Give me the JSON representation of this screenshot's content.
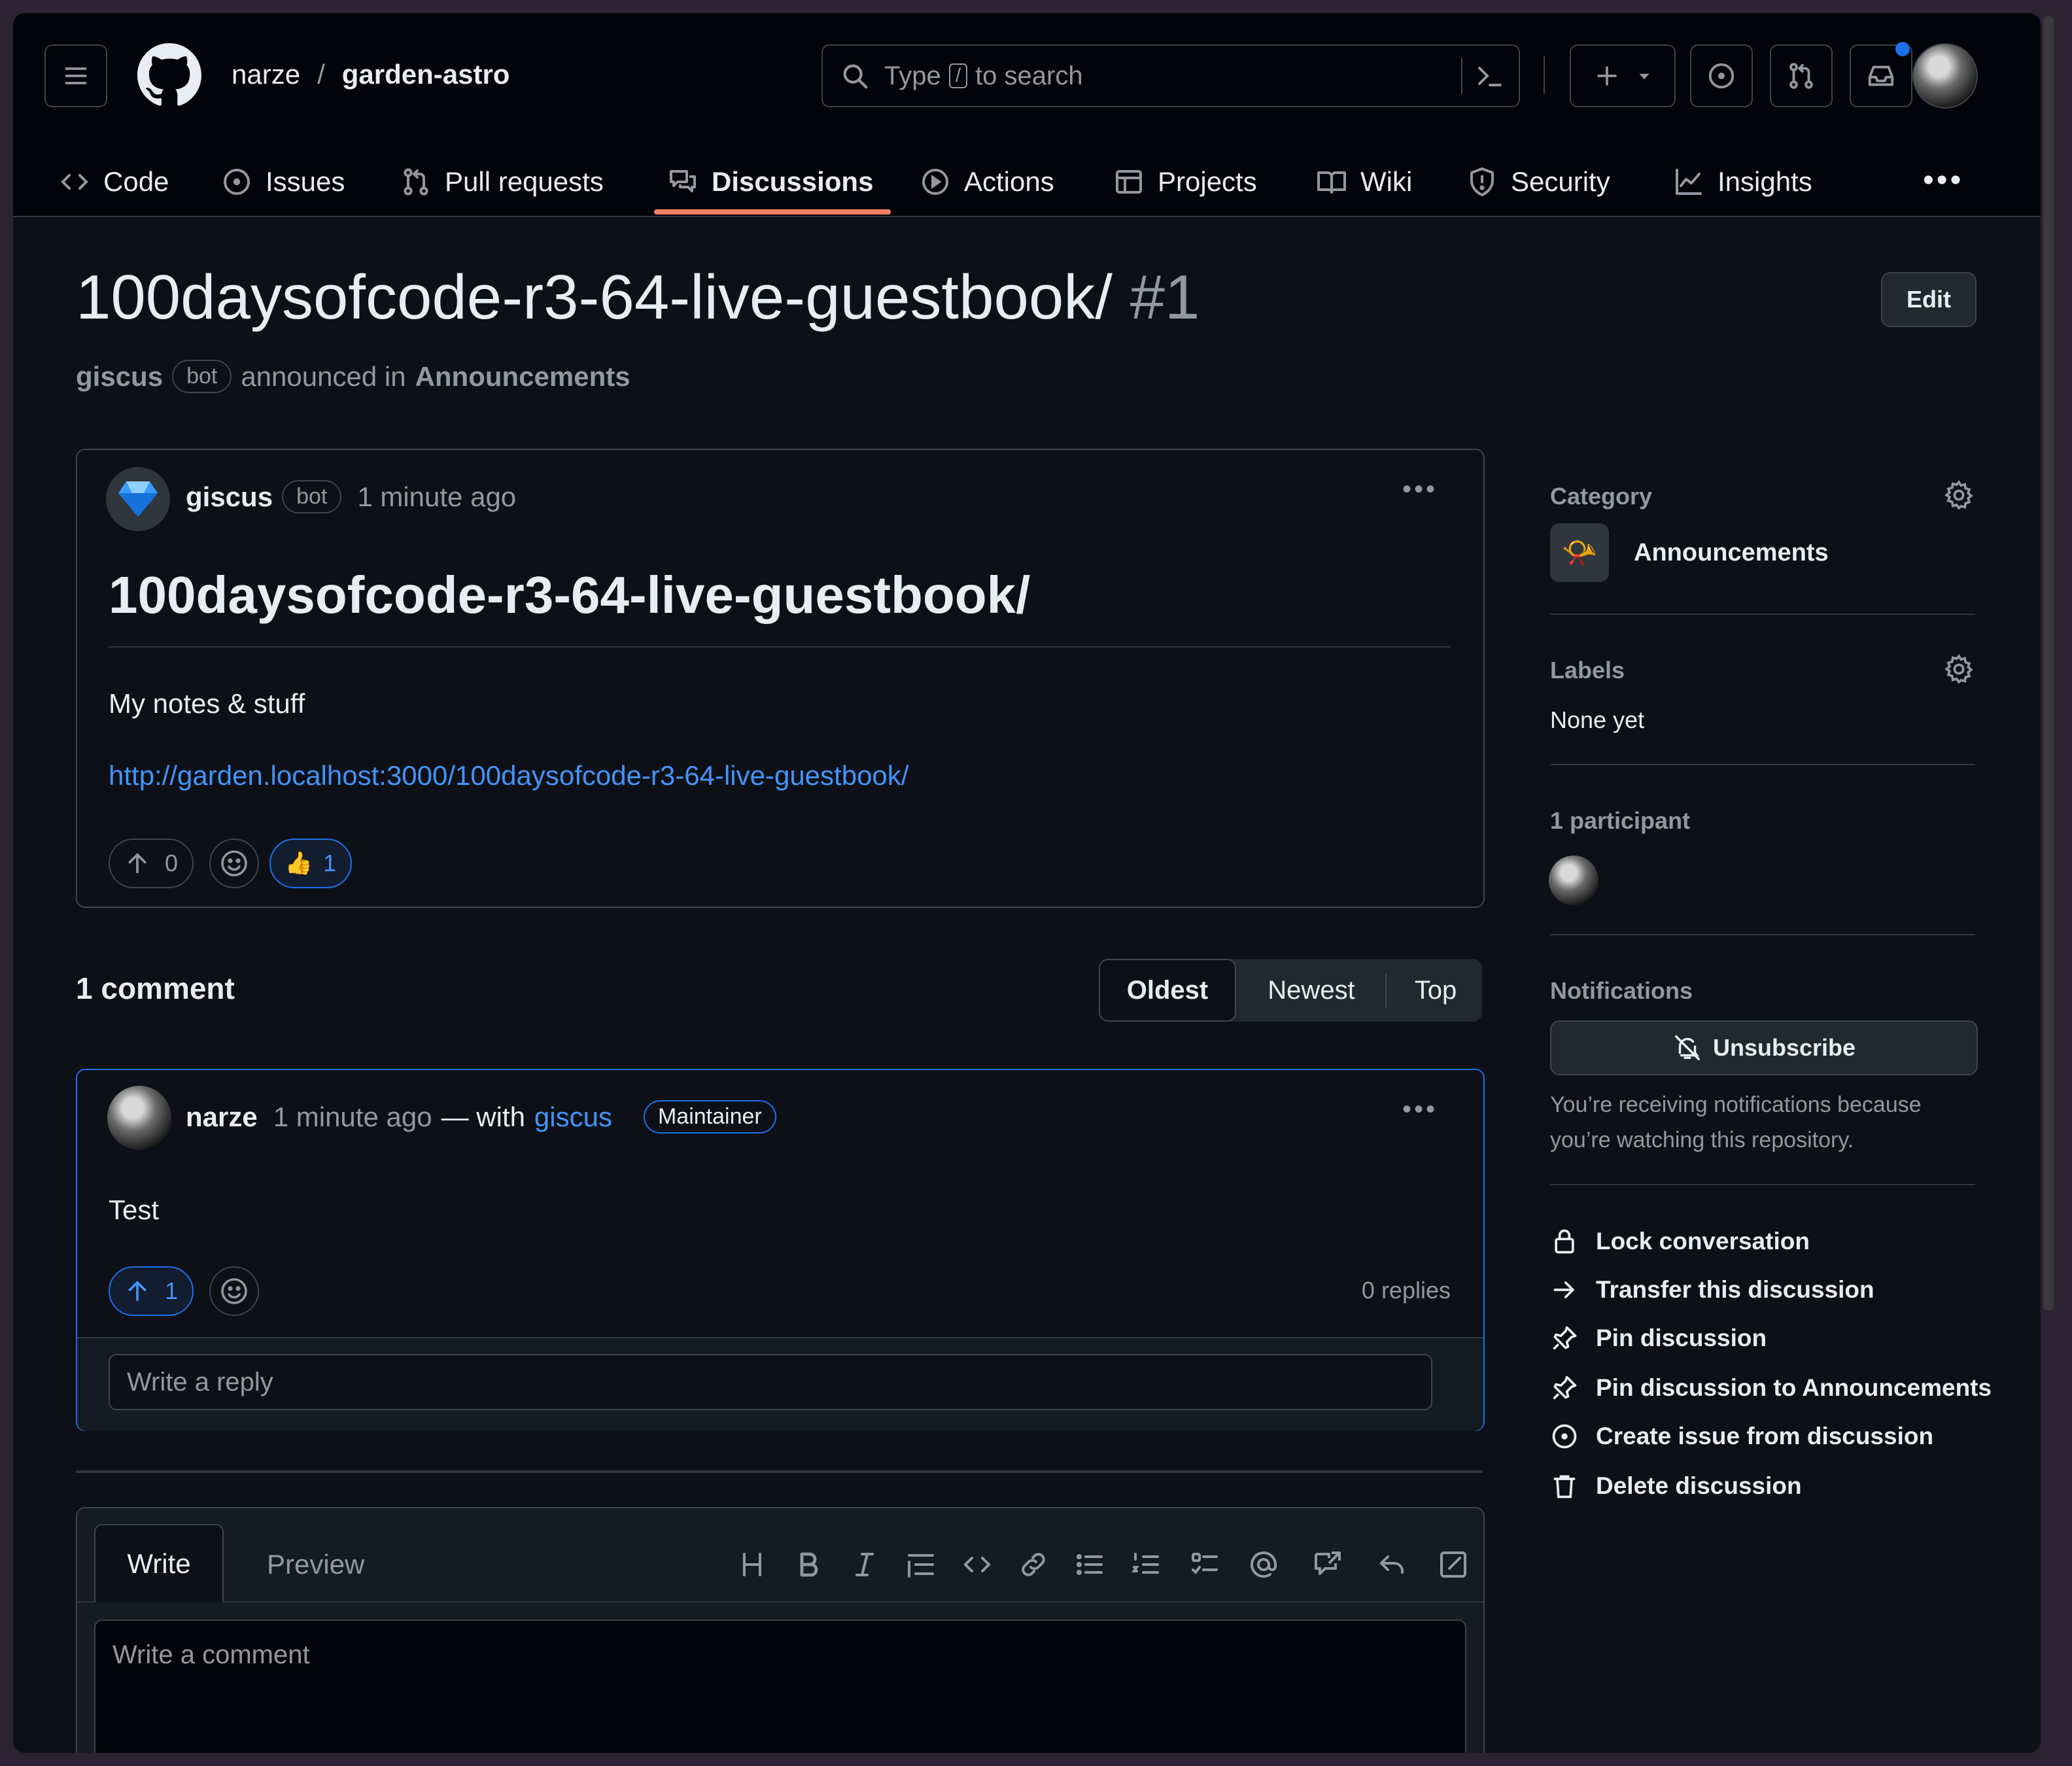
{
  "header": {
    "owner": "narze",
    "separator": "/",
    "repo": "garden-astro",
    "search": {
      "prefix": "Type",
      "key": "/",
      "suffix": "to search"
    }
  },
  "nav": [
    {
      "label": "Code",
      "icon": "code-icon"
    },
    {
      "label": "Issues",
      "icon": "issue-icon"
    },
    {
      "label": "Pull requests",
      "icon": "pull-request-icon"
    },
    {
      "label": "Discussions",
      "icon": "discussion-icon",
      "selected": true
    },
    {
      "label": "Actions",
      "icon": "play-icon"
    },
    {
      "label": "Projects",
      "icon": "table-icon"
    },
    {
      "label": "Wiki",
      "icon": "book-icon"
    },
    {
      "label": "Security",
      "icon": "shield-icon"
    },
    {
      "label": "Insights",
      "icon": "graph-icon"
    }
  ],
  "discussion": {
    "title": "100daysofcode-r3-64-live-guestbook/",
    "number": "#1",
    "edit_label": "Edit",
    "author": "giscus",
    "bot_label": "bot",
    "announced_in": "announced in",
    "category": "Announcements"
  },
  "post": {
    "author": "giscus",
    "bot_label": "bot",
    "time": "1 minute ago",
    "heading": "100daysofcode-r3-64-live-guestbook/",
    "body": "My notes & stuff",
    "link": "http://garden.localhost:3000/100daysofcode-r3-64-live-guestbook/",
    "upvotes": "0",
    "thumbs_up": "1",
    "thumbs_emoji": "👍"
  },
  "comments": {
    "count_label": "1 comment",
    "sort": [
      "Oldest",
      "Newest",
      "Top"
    ],
    "items": [
      {
        "author": "narze",
        "time": "1 minute ago",
        "with_text": "— with",
        "with_link": "giscus",
        "badge": "Maintainer",
        "body": "Test",
        "upvotes": "1",
        "replies": "0 replies",
        "reply_placeholder": "Write a reply"
      }
    ]
  },
  "editor": {
    "tabs": [
      "Write",
      "Preview"
    ],
    "placeholder": "Write a comment"
  },
  "sidebar": {
    "category_head": "Category",
    "category": "Announcements",
    "category_emoji": "📯",
    "labels_head": "Labels",
    "labels_value": "None yet",
    "participants_head": "1 participant",
    "notifications_head": "Notifications",
    "unsubscribe_label": "Unsubscribe",
    "notification_note": "You’re receiving notifications because you’re watching this repository.",
    "actions": [
      {
        "label": "Lock conversation",
        "icon": "lock-icon"
      },
      {
        "label": "Transfer this discussion",
        "icon": "arrow-right-icon"
      },
      {
        "label": "Pin discussion",
        "icon": "pin-icon"
      },
      {
        "label": "Pin discussion to Announcements",
        "icon": "pin-icon"
      },
      {
        "label": "Create issue from discussion",
        "icon": "issue-icon"
      },
      {
        "label": "Delete discussion",
        "icon": "trash-icon"
      }
    ]
  },
  "colors": {
    "background": "#0d1117",
    "header": "#010409",
    "border": "#3d444d",
    "accent_link": "#4493f8",
    "tab_underline": "#f78166",
    "notification_dot": "#1f6feb"
  }
}
